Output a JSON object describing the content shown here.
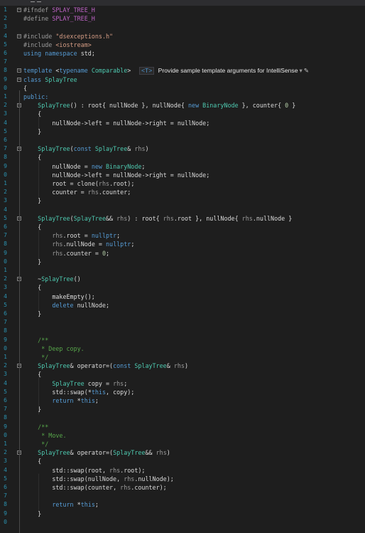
{
  "editor": {
    "line_numbers": [
      "1",
      "2",
      "3",
      "4",
      "5",
      "6",
      "7",
      "8",
      "9",
      "0",
      "1",
      "2",
      "3",
      "4",
      "5",
      "6",
      "7",
      "8",
      "9",
      "0",
      "1",
      "2",
      "3",
      "4",
      "5",
      "6",
      "7",
      "8",
      "9",
      "0",
      "1",
      "2",
      "3",
      "4",
      "5",
      "6",
      "7",
      "8",
      "9",
      "0",
      "1",
      "2",
      "3",
      "4",
      "5",
      "6",
      "7",
      "8",
      "9",
      "0",
      "1",
      "2",
      "3",
      "4",
      "5",
      "6",
      "7",
      "8",
      "9",
      "0",
      "1"
    ],
    "intellisense_hint": {
      "badge": "<T>",
      "text": "Provide sample template arguments for IntelliSense",
      "dropdown_glyph": "▾",
      "edit_icon": "pencil-icon"
    },
    "colors": {
      "background": "#1e1e1e",
      "keyword": "#569cd6",
      "type": "#4ec9b0",
      "string": "#d69d85",
      "comment": "#57a64a",
      "number": "#b5cea8",
      "line_number": "#2b91af"
    },
    "lines": [
      [
        [
          "pp",
          "#ifndef "
        ],
        [
          "macro",
          "SPLAY_TREE_H"
        ]
      ],
      [
        [
          "pp",
          "#define "
        ],
        [
          "macro",
          "SPLAY_TREE_H"
        ]
      ],
      [],
      [
        [
          "pp",
          "#include "
        ],
        [
          "str",
          "\"dsexceptions.h\""
        ]
      ],
      [
        [
          "pp",
          "#include "
        ],
        [
          "str",
          "<iostream>"
        ]
      ],
      [
        [
          "kw",
          "using namespace "
        ],
        [
          "ident",
          "std;"
        ]
      ],
      [],
      [
        [
          "kw",
          "template "
        ],
        [
          "ident",
          "<"
        ],
        [
          "kw",
          "typename "
        ],
        [
          "type",
          "Comparable"
        ],
        [
          "ident",
          ">"
        ]
      ],
      [
        [
          "kw",
          "class "
        ],
        [
          "type",
          "SplayTree"
        ]
      ],
      [
        [
          "ident",
          "{"
        ]
      ],
      [
        [
          "kw",
          "public:"
        ]
      ],
      [
        [
          "ident",
          "    "
        ],
        [
          "type",
          "SplayTree"
        ],
        [
          "ident",
          "() : "
        ],
        [
          "member",
          "root"
        ],
        [
          "ident",
          "{ "
        ],
        [
          "member",
          "nullNode"
        ],
        [
          "ident",
          " }, "
        ],
        [
          "member",
          "nullNode"
        ],
        [
          "ident",
          "{ "
        ],
        [
          "kw",
          "new "
        ],
        [
          "type",
          "BinaryNode"
        ],
        [
          "ident",
          " }, "
        ],
        [
          "member",
          "counter"
        ],
        [
          "ident",
          "{ "
        ],
        [
          "num",
          "0"
        ],
        [
          "ident",
          " }"
        ]
      ],
      [
        [
          "ident",
          "    {"
        ]
      ],
      [
        [
          "ident",
          "        "
        ],
        [
          "member",
          "nullNode"
        ],
        [
          "ident",
          "->"
        ],
        [
          "member",
          "left"
        ],
        [
          "ident",
          " = "
        ],
        [
          "member",
          "nullNode"
        ],
        [
          "ident",
          "->"
        ],
        [
          "member",
          "right"
        ],
        [
          "ident",
          " = "
        ],
        [
          "member",
          "nullNode"
        ],
        [
          "ident",
          ";"
        ]
      ],
      [
        [
          "ident",
          "    }"
        ]
      ],
      [],
      [
        [
          "ident",
          "    "
        ],
        [
          "type",
          "SplayTree"
        ],
        [
          "ident",
          "("
        ],
        [
          "kw",
          "const "
        ],
        [
          "type",
          "SplayTree"
        ],
        [
          "ident",
          "& "
        ],
        [
          "param",
          "rhs"
        ],
        [
          "ident",
          ")"
        ]
      ],
      [
        [
          "ident",
          "    {"
        ]
      ],
      [
        [
          "ident",
          "        "
        ],
        [
          "member",
          "nullNode"
        ],
        [
          "ident",
          " = "
        ],
        [
          "kw",
          "new "
        ],
        [
          "type",
          "BinaryNode"
        ],
        [
          "ident",
          ";"
        ]
      ],
      [
        [
          "ident",
          "        "
        ],
        [
          "member",
          "nullNode"
        ],
        [
          "ident",
          "->"
        ],
        [
          "member",
          "left"
        ],
        [
          "ident",
          " = "
        ],
        [
          "member",
          "nullNode"
        ],
        [
          "ident",
          "->"
        ],
        [
          "member",
          "right"
        ],
        [
          "ident",
          " = "
        ],
        [
          "member",
          "nullNode"
        ],
        [
          "ident",
          ";"
        ]
      ],
      [
        [
          "ident",
          "        "
        ],
        [
          "member",
          "root"
        ],
        [
          "ident",
          " = "
        ],
        [
          "ident",
          "clone("
        ],
        [
          "param",
          "rhs"
        ],
        [
          "ident",
          "."
        ],
        [
          "member",
          "root"
        ],
        [
          "ident",
          ");"
        ]
      ],
      [
        [
          "ident",
          "        "
        ],
        [
          "member",
          "counter"
        ],
        [
          "ident",
          " = "
        ],
        [
          "param",
          "rhs"
        ],
        [
          "ident",
          "."
        ],
        [
          "member",
          "counter"
        ],
        [
          "ident",
          ";"
        ]
      ],
      [
        [
          "ident",
          "    }"
        ]
      ],
      [],
      [
        [
          "ident",
          "    "
        ],
        [
          "type",
          "SplayTree"
        ],
        [
          "ident",
          "("
        ],
        [
          "type",
          "SplayTree"
        ],
        [
          "ident",
          "&& "
        ],
        [
          "param",
          "rhs"
        ],
        [
          "ident",
          ") : "
        ],
        [
          "member",
          "root"
        ],
        [
          "ident",
          "{ "
        ],
        [
          "param",
          "rhs"
        ],
        [
          "ident",
          "."
        ],
        [
          "member",
          "root"
        ],
        [
          "ident",
          " }, "
        ],
        [
          "member",
          "nullNode"
        ],
        [
          "ident",
          "{ "
        ],
        [
          "param",
          "rhs"
        ],
        [
          "ident",
          "."
        ],
        [
          "member",
          "nullNode"
        ],
        [
          "ident",
          " }"
        ]
      ],
      [
        [
          "ident",
          "    {"
        ]
      ],
      [
        [
          "ident",
          "        "
        ],
        [
          "param",
          "rhs"
        ],
        [
          "ident",
          "."
        ],
        [
          "member",
          "root"
        ],
        [
          "ident",
          " = "
        ],
        [
          "kw",
          "nullptr"
        ],
        [
          "ident",
          ";"
        ]
      ],
      [
        [
          "ident",
          "        "
        ],
        [
          "param",
          "rhs"
        ],
        [
          "ident",
          "."
        ],
        [
          "member",
          "nullNode"
        ],
        [
          "ident",
          " = "
        ],
        [
          "kw",
          "nullptr"
        ],
        [
          "ident",
          ";"
        ]
      ],
      [
        [
          "ident",
          "        "
        ],
        [
          "param",
          "rhs"
        ],
        [
          "ident",
          "."
        ],
        [
          "member",
          "counter"
        ],
        [
          "ident",
          " = "
        ],
        [
          "num",
          "0"
        ],
        [
          "ident",
          ";"
        ]
      ],
      [
        [
          "ident",
          "    }"
        ]
      ],
      [],
      [
        [
          "ident",
          "    ~"
        ],
        [
          "type",
          "SplayTree"
        ],
        [
          "ident",
          "()"
        ]
      ],
      [
        [
          "ident",
          "    {"
        ]
      ],
      [
        [
          "ident",
          "        makeEmpty();"
        ]
      ],
      [
        [
          "ident",
          "        "
        ],
        [
          "kw",
          "delete "
        ],
        [
          "member",
          "nullNode"
        ],
        [
          "ident",
          ";"
        ]
      ],
      [
        [
          "ident",
          "    }"
        ]
      ],
      [],
      [],
      [
        [
          "ident",
          "    "
        ],
        [
          "cmt",
          "/**"
        ]
      ],
      [
        [
          "ident",
          "    "
        ],
        [
          "cmt",
          " * Deep copy."
        ]
      ],
      [
        [
          "ident",
          "    "
        ],
        [
          "cmt",
          " */"
        ]
      ],
      [
        [
          "ident",
          "    "
        ],
        [
          "type",
          "SplayTree"
        ],
        [
          "ident",
          "& operator=("
        ],
        [
          "kw",
          "const "
        ],
        [
          "type",
          "SplayTree"
        ],
        [
          "ident",
          "& "
        ],
        [
          "param",
          "rhs"
        ],
        [
          "ident",
          ")"
        ]
      ],
      [
        [
          "ident",
          "    {"
        ]
      ],
      [
        [
          "ident",
          "        "
        ],
        [
          "type",
          "SplayTree"
        ],
        [
          "ident",
          " copy = "
        ],
        [
          "param",
          "rhs"
        ],
        [
          "ident",
          ";"
        ]
      ],
      [
        [
          "ident",
          "        std::swap(*"
        ],
        [
          "kw",
          "this"
        ],
        [
          "ident",
          ", copy);"
        ]
      ],
      [
        [
          "ident",
          "        "
        ],
        [
          "kw",
          "return "
        ],
        [
          "ident",
          "*"
        ],
        [
          "kw",
          "this"
        ],
        [
          "ident",
          ";"
        ]
      ],
      [
        [
          "ident",
          "    }"
        ]
      ],
      [],
      [
        [
          "ident",
          "    "
        ],
        [
          "cmt",
          "/**"
        ]
      ],
      [
        [
          "ident",
          "    "
        ],
        [
          "cmt",
          " * Move."
        ]
      ],
      [
        [
          "ident",
          "    "
        ],
        [
          "cmt",
          " */"
        ]
      ],
      [
        [
          "ident",
          "    "
        ],
        [
          "type",
          "SplayTree"
        ],
        [
          "ident",
          "& operator=("
        ],
        [
          "type",
          "SplayTree"
        ],
        [
          "ident",
          "&& "
        ],
        [
          "param",
          "rhs"
        ],
        [
          "ident",
          ")"
        ]
      ],
      [
        [
          "ident",
          "    {"
        ]
      ],
      [
        [
          "ident",
          "        std::swap("
        ],
        [
          "member",
          "root"
        ],
        [
          "ident",
          ", "
        ],
        [
          "param",
          "rhs"
        ],
        [
          "ident",
          "."
        ],
        [
          "member",
          "root"
        ],
        [
          "ident",
          ");"
        ]
      ],
      [
        [
          "ident",
          "        std::swap("
        ],
        [
          "member",
          "nullNode"
        ],
        [
          "ident",
          ", "
        ],
        [
          "param",
          "rhs"
        ],
        [
          "ident",
          "."
        ],
        [
          "member",
          "nullNode"
        ],
        [
          "ident",
          ");"
        ]
      ],
      [
        [
          "ident",
          "        std::swap("
        ],
        [
          "member",
          "counter"
        ],
        [
          "ident",
          ", "
        ],
        [
          "param",
          "rhs"
        ],
        [
          "ident",
          "."
        ],
        [
          "member",
          "counter"
        ],
        [
          "ident",
          ");"
        ]
      ],
      [],
      [
        [
          "ident",
          "        "
        ],
        [
          "kw",
          "return "
        ],
        [
          "ident",
          "*"
        ],
        [
          "kw",
          "this"
        ],
        [
          "ident",
          ";"
        ]
      ],
      [
        [
          "ident",
          "    }"
        ]
      ],
      []
    ],
    "fold_markers": [
      "0",
      "",
      "",
      "2",
      "",
      "",
      "",
      "8",
      "",
      "",
      "",
      "11",
      "",
      "",
      "",
      "",
      "16",
      "",
      "",
      "",
      "",
      "",
      "",
      "",
      "24",
      "",
      "",
      "",
      "",
      "",
      "",
      "31",
      "",
      "",
      "",
      "",
      "",
      "",
      "",
      "",
      "",
      "41",
      "",
      "",
      "",
      "",
      "",
      "",
      "",
      "",
      "",
      "51"
    ]
  }
}
